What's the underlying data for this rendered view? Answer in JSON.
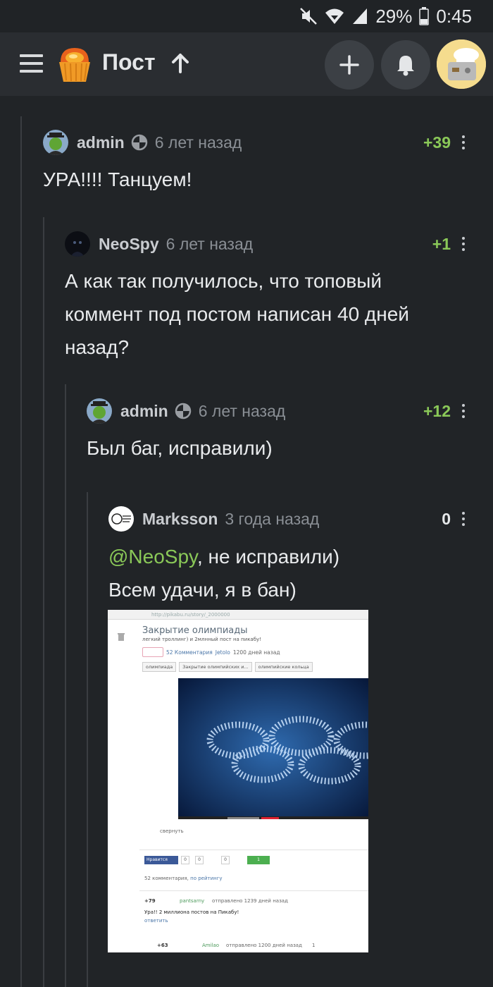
{
  "status_bar": {
    "battery": "29%",
    "time": "0:45",
    "icons": [
      "mute-icon",
      "wifi-icon",
      "signal-icon",
      "battery-icon"
    ]
  },
  "app_bar": {
    "title": "Пост",
    "icons": [
      "menu-icon",
      "pikabu-logo",
      "up-arrow-icon",
      "plus-icon",
      "bell-icon",
      "user-avatar"
    ]
  },
  "colors": {
    "background": "#212427",
    "app_bar": "#2a2d31",
    "rating_positive": "#8ac858",
    "mention": "#8ac858",
    "text": "#e9ebed",
    "muted": "#8a8f95"
  },
  "comments": [
    {
      "user": "admin",
      "has_badge": true,
      "time": "6 лет назад",
      "score": "+39",
      "text": [
        "УРА!!!! Танцуем!"
      ]
    },
    {
      "user": "NeoSpy",
      "has_badge": false,
      "time": "6 лет назад",
      "score": "+1",
      "text": [
        "А как так получилось, что топовый",
        "коммент под постом написан 40 дней",
        "назад?"
      ]
    },
    {
      "user": "admin",
      "has_badge": true,
      "time": "6 лет назад",
      "score": "+12",
      "text": [
        "Был баг, исправили)"
      ]
    },
    {
      "user": "Marksson",
      "has_badge": false,
      "time": "3 года назад",
      "score": "0",
      "mention": "@NeoSpy",
      "text": [
        ", не исправили)",
        "Всем удачи, я в бан)"
      ]
    }
  ],
  "embedded_screenshot": {
    "url": "http://pikabu.ru/story/_2000000",
    "title": "Закрытие олимпиады",
    "subtitle": "легкий троллинг) и 2млнный пост на пикабу!",
    "comments_link": "52 Комментария",
    "author": "Jetolo",
    "posted": "1200 дней назад",
    "tags": [
      "олимпиада",
      "Закрытие олимпийских и...",
      "олимпийские кольца"
    ],
    "collapse": "свернуть",
    "like_button": "Нравится",
    "share_counts": [
      "0",
      "0",
      "0",
      "1"
    ],
    "comments_sort": "52 комментария,",
    "sort_by": "по рейтингу",
    "c1_score": "+79",
    "c1_user": "pantsarny",
    "c1_meta": "отправлено 1239 дней назад",
    "c1_text": "Ура!! 2 миллиона постов на Пикабу!",
    "reply": "ответить",
    "c2_score": "+63",
    "c2_user": "Amilao",
    "c2_meta": "отправлено 1200 дней назад",
    "c2_count": "1"
  }
}
